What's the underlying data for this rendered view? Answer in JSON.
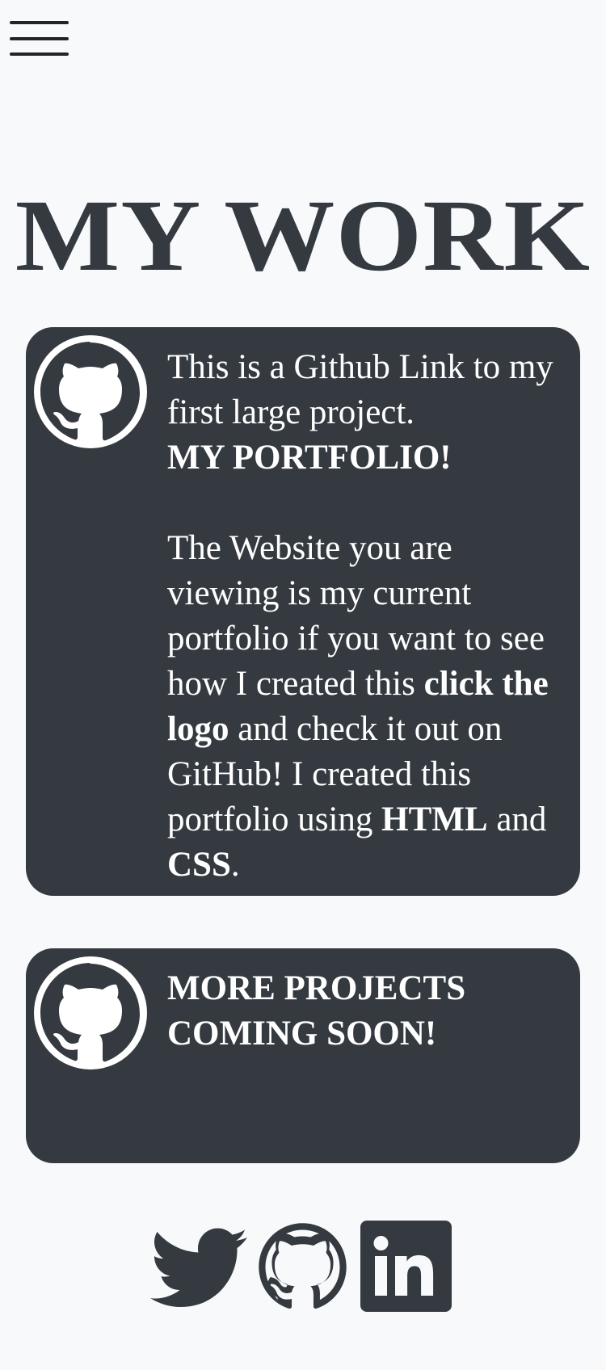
{
  "nav": {
    "menu_icon": "hamburger-menu-icon"
  },
  "page": {
    "title": "MY WORK"
  },
  "cards": [
    {
      "icon": "github-icon",
      "line1": "This is a Github Link to my first large project.",
      "line2": "MY PORTFOLIO!",
      "para_start": "The Website you are viewing is my current portfolio if you want to see how I created this ",
      "para_bold_link": "click the logo",
      "para_mid": " and check it out on GitHub! I created this portfolio using ",
      "para_html": "HTML",
      "para_and": " and ",
      "para_css": "CSS",
      "para_end": "."
    },
    {
      "icon": "github-icon",
      "heading": "MORE PROJECTS COMING SOON!"
    }
  ],
  "footer": {
    "links": [
      {
        "icon": "twitter-icon"
      },
      {
        "icon": "github-icon"
      },
      {
        "icon": "linkedin-icon"
      }
    ]
  },
  "colors": {
    "background": "#f8f9fa",
    "card": "#343a40",
    "text_on_card": "#ffffff",
    "title": "#343a40"
  }
}
